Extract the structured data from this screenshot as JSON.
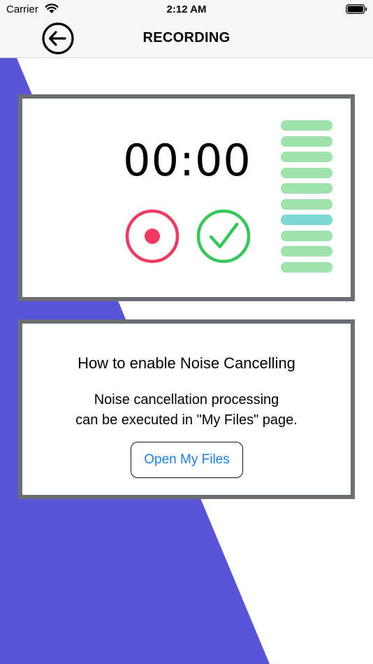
{
  "status_bar": {
    "carrier": "Carrier",
    "time": "2:12 AM"
  },
  "nav": {
    "title": "RECORDING",
    "back_icon": "arrow-left-circle-icon"
  },
  "recorder": {
    "timer": "00:00",
    "record_icon": "record-icon",
    "done_icon": "checkmark-circle-icon",
    "level_meter": {
      "segments": 10,
      "active_index": 6,
      "color_idle": "#9fe2ad",
      "color_active": "#7ed7d2"
    }
  },
  "info": {
    "title": "How to enable Noise Cancelling",
    "body_line1": "Noise cancellation processing",
    "body_line2": "can be executed in \"My Files\" page.",
    "button_label": "Open My Files"
  },
  "colors": {
    "background_accent": "#5a55d6",
    "card_border": "#6b6e74",
    "record_red": "#f03a5f",
    "done_green": "#34c759",
    "link_blue": "#1a7ff5"
  }
}
